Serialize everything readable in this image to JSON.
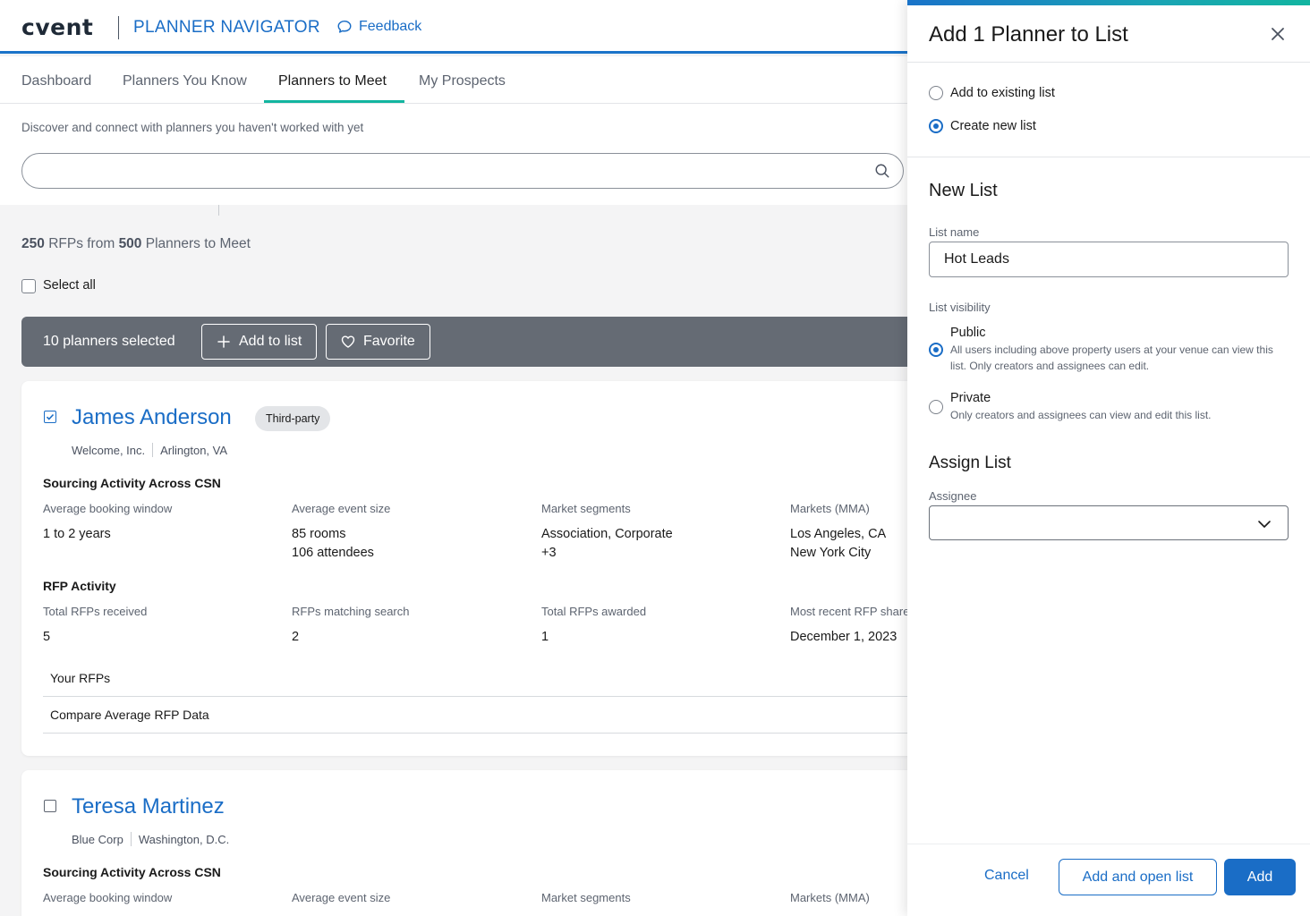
{
  "header": {
    "logo": "cvent",
    "app_title": "PLANNER NAVIGATOR",
    "feedback_label": "Feedback"
  },
  "tabs": [
    {
      "label": "Dashboard",
      "active": false
    },
    {
      "label": "Planners You Know",
      "active": false
    },
    {
      "label": "Planners to Meet",
      "active": true
    },
    {
      "label": "My Prospects",
      "active": false
    }
  ],
  "intro": {
    "text": "Discover and connect with planners you haven't worked with yet",
    "search_value": "",
    "search_icon": "search-icon"
  },
  "results": {
    "rfp_count": "250",
    "rfp_text": "RFPs from",
    "planner_count": "500",
    "planner_text": "Planners to Meet"
  },
  "select_all": {
    "label": "Select all",
    "checked": false
  },
  "selection_bar": {
    "text": "10 planners selected",
    "add_to_list_label": "Add to list",
    "favorite_label": "Favorite"
  },
  "planners": [
    {
      "name": "James Anderson",
      "checked": true,
      "badge": "Third-party",
      "company": "Welcome, Inc.",
      "location": "Arlington, VA",
      "sourcing_title": "Sourcing Activity Across CSN",
      "sourcing": {
        "booking_window_label": "Average booking window",
        "booking_window": "1 to 2 years",
        "event_size_label": "Average event size",
        "event_size_rooms": "85 rooms",
        "event_size_attendees": "106 attendees",
        "segments_label": "Market segments",
        "segments": "Association, Corporate",
        "segments_more": "+3",
        "markets_label": "Markets (MMA)",
        "markets_1": "Los Angeles, CA",
        "markets_2": "New York City"
      },
      "rfp_title": "RFP Activity",
      "rfp": {
        "total_received_label": "Total RFPs received",
        "total_received": "5",
        "matching_label": "RFPs matching search",
        "matching": "2",
        "awarded_label": "Total RFPs awarded",
        "awarded": "1",
        "recent_label": "Most recent RFP shared",
        "recent": "December 1, 2023"
      },
      "links": [
        "Your RFPs",
        "Compare Average RFP Data"
      ]
    },
    {
      "name": "Teresa Martinez",
      "checked": false,
      "company": "Blue Corp",
      "location": "Washington, D.C.",
      "sourcing_title": "Sourcing Activity Across CSN",
      "sourcing": {
        "booking_window_label": "Average booking window",
        "event_size_label": "Average event size",
        "segments_label": "Market segments",
        "markets_label": "Markets (MMA)"
      }
    }
  ],
  "panel": {
    "title": "Add 1 Planner to List",
    "close_icon": "close-icon",
    "options": [
      {
        "label": "Add to existing list",
        "selected": false
      },
      {
        "label": "Create new list",
        "selected": true
      }
    ],
    "new_list_heading": "New List",
    "list_name_label": "List name",
    "list_name_value": "Hot Leads",
    "visibility_label": "List visibility",
    "visibility": [
      {
        "label": "Public",
        "description": "All users including above property users at your venue can view this list. Only creators and assignees can edit.",
        "selected": true
      },
      {
        "label": "Private",
        "description": "Only creators and assignees can view and edit this list.",
        "selected": false
      }
    ],
    "assign_heading": "Assign List",
    "assignee_label": "Assignee",
    "assignee_value": "",
    "cancel_label": "Cancel",
    "add_open_label": "Add and open list",
    "add_label": "Add"
  },
  "colors": {
    "brand_blue": "#1a6dc6",
    "accent_teal": "#12b5a0",
    "selection_bar": "#656b74"
  }
}
